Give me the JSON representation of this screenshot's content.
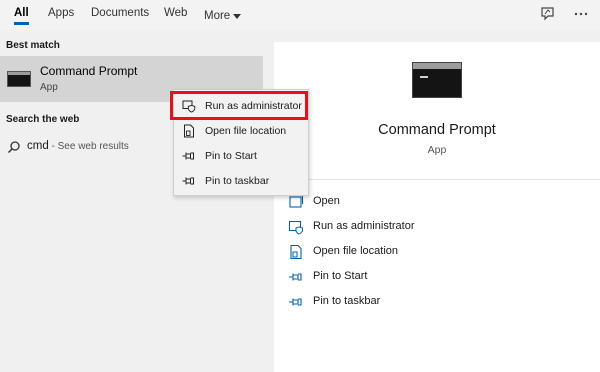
{
  "tabs": [
    {
      "label": "All",
      "active": true
    },
    {
      "label": "Apps"
    },
    {
      "label": "Documents"
    },
    {
      "label": "Web"
    },
    {
      "label": "More"
    }
  ],
  "toolbar_icons": [
    "feedback-icon",
    "ellipsis-icon"
  ],
  "results": {
    "best_match_heading": "Best match",
    "best_match": {
      "title": "Command Prompt",
      "subtitle": "App",
      "icon": "cmd-icon"
    },
    "search_web_heading": "Search the web",
    "web_query": "cmd",
    "web_hint": " - See web results"
  },
  "context_menu": {
    "items": [
      {
        "label": "Run as administrator",
        "icon": "shield-window-icon",
        "highlighted": true
      },
      {
        "label": "Open file location",
        "icon": "file-location-icon"
      },
      {
        "label": "Pin to Start",
        "icon": "pin-icon"
      },
      {
        "label": "Pin to taskbar",
        "icon": "pin-icon"
      }
    ],
    "highlight_color": "#e0141e"
  },
  "preview": {
    "title": "Command Prompt",
    "subtitle": "App",
    "actions": [
      {
        "label": "Open",
        "icon": "open-icon"
      },
      {
        "label": "Run as administrator",
        "icon": "shield-window-icon"
      },
      {
        "label": "Open file location",
        "icon": "file-location-icon"
      },
      {
        "label": "Pin to Start",
        "icon": "pin-icon"
      },
      {
        "label": "Pin to taskbar",
        "icon": "pin-icon"
      }
    ]
  },
  "colors": {
    "accent": "#0063b1",
    "pane_bg": "#f0f0f0",
    "selected_row": "#d4d4d4"
  }
}
